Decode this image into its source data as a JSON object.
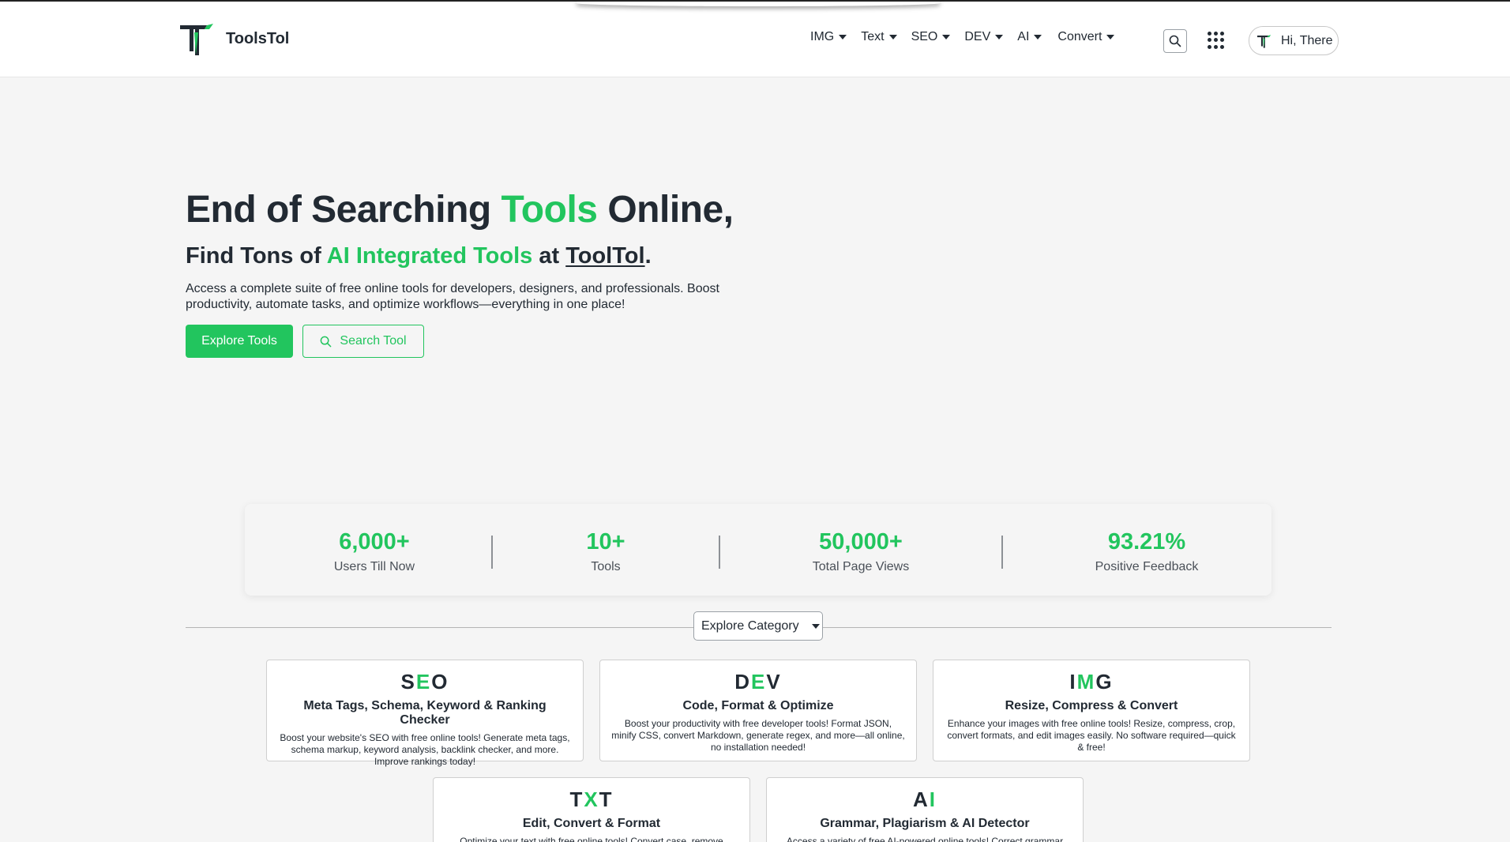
{
  "brand": {
    "name": "ToolsTol"
  },
  "nav": {
    "items": [
      {
        "label": "IMG"
      },
      {
        "label": "Text"
      },
      {
        "label": "SEO"
      },
      {
        "label": "DEV"
      },
      {
        "label": "AI"
      },
      {
        "label": "Convert"
      }
    ],
    "user_label": "Hi, There"
  },
  "hero": {
    "title_pre": "End of Searching ",
    "title_highlight": "Tools",
    "title_post": " Online,",
    "sub_pre": "Find Tons of ",
    "sub_highlight": "AI Integrated Tools",
    "sub_mid": " at ",
    "sub_brand": "ToolTol",
    "sub_post": ".",
    "description": "Access a complete suite of free online tools for developers, designers, and professionals. Boost productivity, automate tasks, and optimize workflows—everything in one place!",
    "primary_button": "Explore Tools",
    "secondary_button": "Search Tool"
  },
  "stats": [
    {
      "value": "6,000+",
      "label": "Users Till Now"
    },
    {
      "value": "10+",
      "label": "Tools"
    },
    {
      "value": "50,000+",
      "label": "Total Page Views"
    },
    {
      "value": "93.21%",
      "label": "Positive Feedback"
    }
  ],
  "category_select": {
    "label": "Explore Category"
  },
  "cards": [
    {
      "code_a": "S",
      "code_b": "E",
      "code_c": "O",
      "title": "Meta Tags, Schema, Keyword & Ranking Checker",
      "desc": "Boost your website's SEO with free online tools! Generate meta tags, schema markup, keyword analysis, backlink checker, and more. Improve rankings today!"
    },
    {
      "code_a": "D",
      "code_b": "E",
      "code_c": "V",
      "title": "Code, Format & Optimize",
      "desc": "Boost your productivity with free developer tools! Format JSON, minify CSS, convert Markdown, generate regex, and more—all online, no installation needed!"
    },
    {
      "code_a": "I",
      "code_b": "M",
      "code_c": "G",
      "title": "Resize, Compress & Convert",
      "desc": "Enhance your images with free online tools! Resize, compress, crop, convert formats, and edit images easily. No software required—quick & free!"
    },
    {
      "code_a": "T",
      "code_b": "X",
      "code_c": "T",
      "title": "Edit, Convert & Format",
      "desc": "Optimize your text with free online tools! Convert case, remove"
    },
    {
      "code_a": "A",
      "code_b": "I",
      "code_c": "",
      "title": "Grammar, Plagiarism & AI Detector",
      "desc": "Access a variety of free AI-powered online tools! Correct grammar"
    }
  ],
  "colors": {
    "accent": "#22c55e",
    "text": "#222a33",
    "background": "#f5f5f5"
  }
}
